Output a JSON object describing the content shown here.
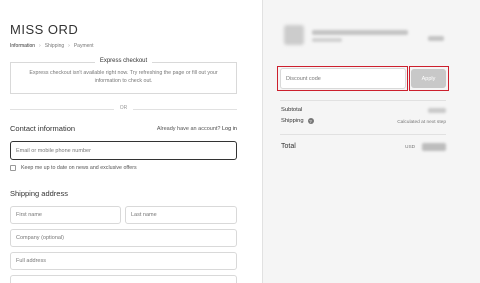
{
  "store": {
    "name": "MISS ORD"
  },
  "breadcrumb": [
    {
      "label": "Information"
    },
    {
      "label": "Shipping"
    },
    {
      "label": "Payment"
    }
  ],
  "breadcrumb_separator": "›",
  "express": {
    "title": "Express checkout",
    "message": "Express checkout isn't available right now. Try refreshing the page or fill out your information to check out."
  },
  "or_text": "OR",
  "contact": {
    "title": "Contact information",
    "account_prompt": "Already have an account?",
    "login_label": "Log in",
    "email_placeholder": "Email or mobile phone number",
    "newsletter_label": "Keep me up to date on news and exclusive offers"
  },
  "shipping": {
    "title": "Shipping address",
    "first_name_placeholder": "First name",
    "last_name_placeholder": "Last name",
    "company_placeholder": "Company (optional)",
    "address_placeholder": "Full address"
  },
  "summary": {
    "discount_placeholder": "Discount code",
    "apply_label": "Apply",
    "subtotal_label": "Subtotal",
    "shipping_label": "Shipping",
    "shipping_help_icon": "question-circle-icon",
    "shipping_note": "Calculated at next step",
    "total_label": "Total",
    "currency": "USD"
  },
  "colors": {
    "highlight": "#cc1f2d",
    "apply_button": "#c8c8c8",
    "sidebar_bg": "#f5f5f5"
  }
}
